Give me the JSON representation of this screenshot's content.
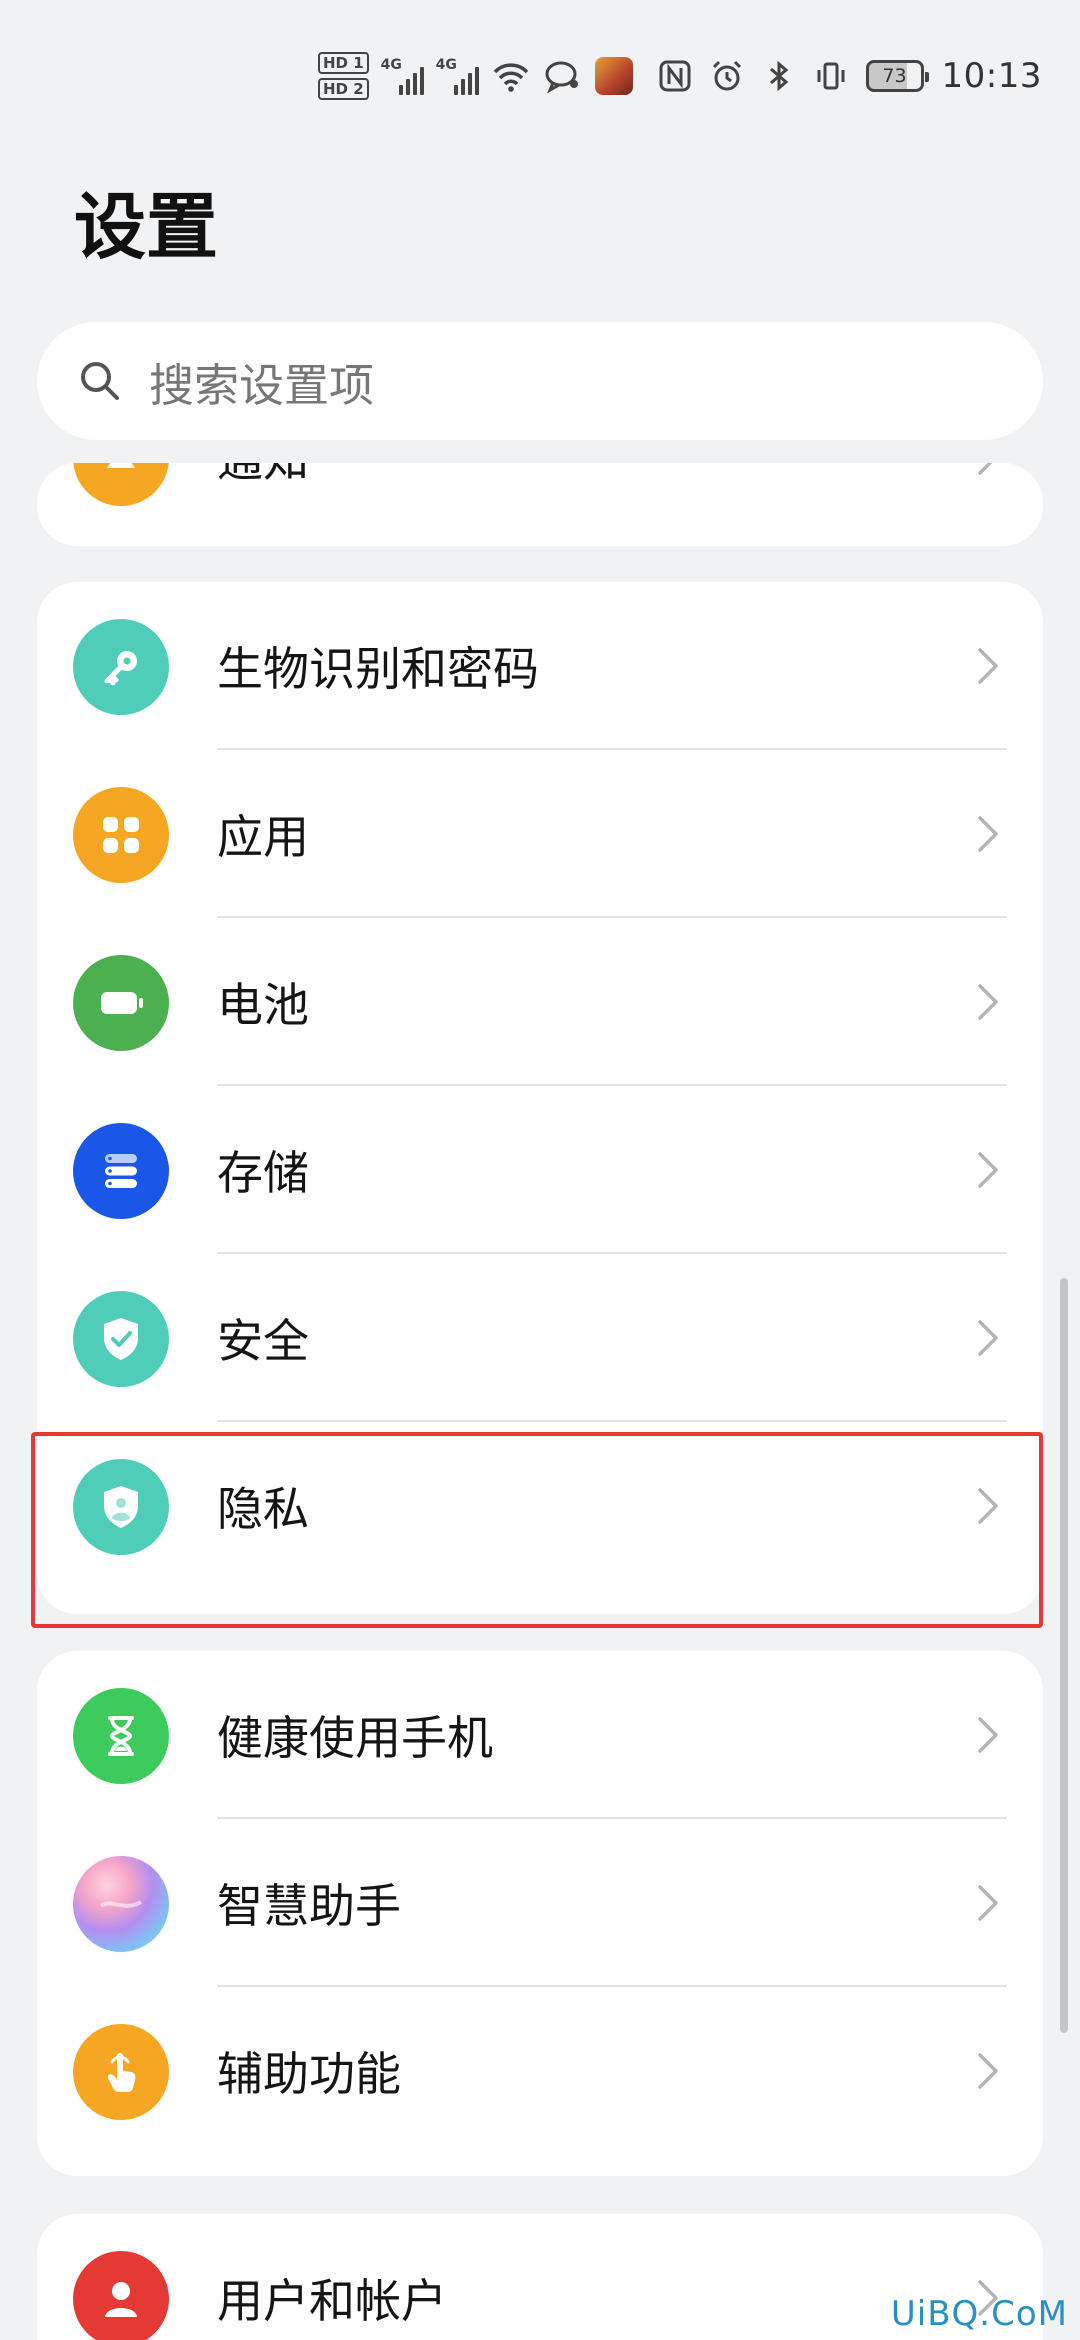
{
  "status_bar": {
    "hd1": "HD 1",
    "hd2": "HD 2",
    "net1": "4G",
    "net2": "4G",
    "battery": "73",
    "time": "10:13"
  },
  "page_title": "设置",
  "search": {
    "placeholder": "搜索设置项"
  },
  "partial_item": {
    "label": "通知",
    "icon": "bell-icon",
    "color": "#f5a623"
  },
  "group1": [
    {
      "label": "生物识别和密码",
      "icon": "key-icon",
      "color": "#4fcdb8"
    },
    {
      "label": "应用",
      "icon": "apps-grid-icon",
      "color": "#f5a623"
    },
    {
      "label": "电池",
      "icon": "battery-icon",
      "color": "#4caf50"
    },
    {
      "label": "存储",
      "icon": "storage-icon",
      "color": "#1a56e8"
    },
    {
      "label": "安全",
      "icon": "shield-check-icon",
      "color": "#4fcdb8"
    },
    {
      "label": "隐私",
      "icon": "privacy-shield-icon",
      "color": "#4fcdb8"
    }
  ],
  "group2": [
    {
      "label": "健康使用手机",
      "icon": "hourglass-icon",
      "color": "#3ecb5d"
    },
    {
      "label": "智慧助手",
      "icon": "assistant-orb-icon",
      "color": "#b58ef0"
    },
    {
      "label": "辅助功能",
      "icon": "hand-icon",
      "color": "#f5a623"
    }
  ],
  "group3": [
    {
      "label": "用户和帐户",
      "icon": "user-icon",
      "color": "#e53935"
    }
  ],
  "watermark": "UiBQ.CoM"
}
